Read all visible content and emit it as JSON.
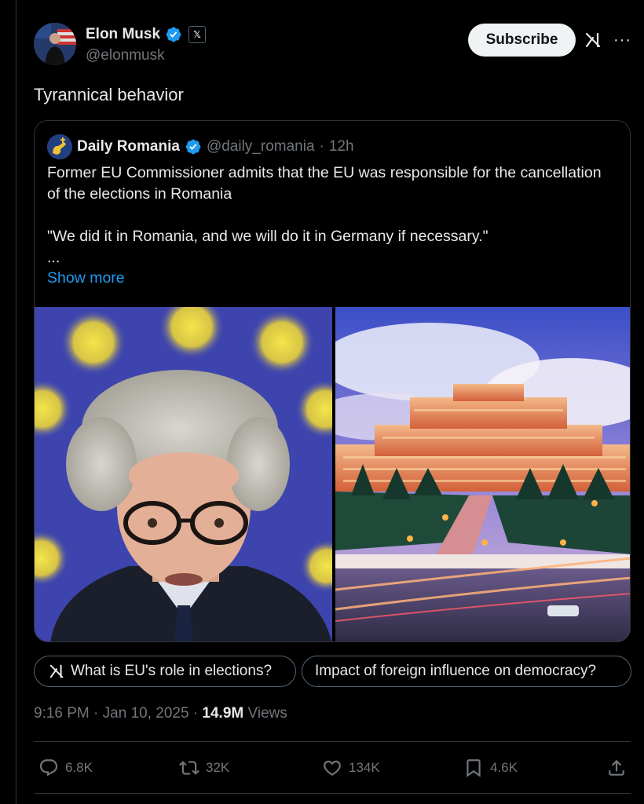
{
  "post": {
    "author_name": "Elon Musk",
    "author_handle": "@elonmusk",
    "x_badge": "𝕏",
    "subscribe_label": "Subscribe",
    "more_label": "···",
    "text": "Tyrannical behavior"
  },
  "quote": {
    "author_name": "Daily Romania",
    "author_handle": "@daily_romania",
    "separator": "·",
    "time": "12h",
    "line1": "Former EU Commissioner admits that the EU was responsible for the cancellation of the elections in Romania",
    "line2": "\"We did it in Romania, and we will do it in Germany if necessary.\"",
    "ellipsis": "...",
    "show_more": "Show more"
  },
  "chips": [
    {
      "label": "What is EU's role in elections?",
      "icon": "grok-icon"
    },
    {
      "label": "Impact of foreign influence on democracy?"
    }
  ],
  "meta": {
    "time": "9:16 PM",
    "dot1": "·",
    "date": "Jan 10, 2025",
    "dot2": "·",
    "views_count": "14.9M",
    "views_label": "Views"
  },
  "actions": {
    "replies": "6.8K",
    "reposts": "32K",
    "likes": "134K",
    "bookmarks": "4.6K"
  },
  "colors": {
    "background": "#000000",
    "text": "#e7e9ea",
    "muted": "#71767b",
    "link": "#1d9bf0",
    "verified": "#1d9bf0",
    "border": "#2f3336"
  }
}
